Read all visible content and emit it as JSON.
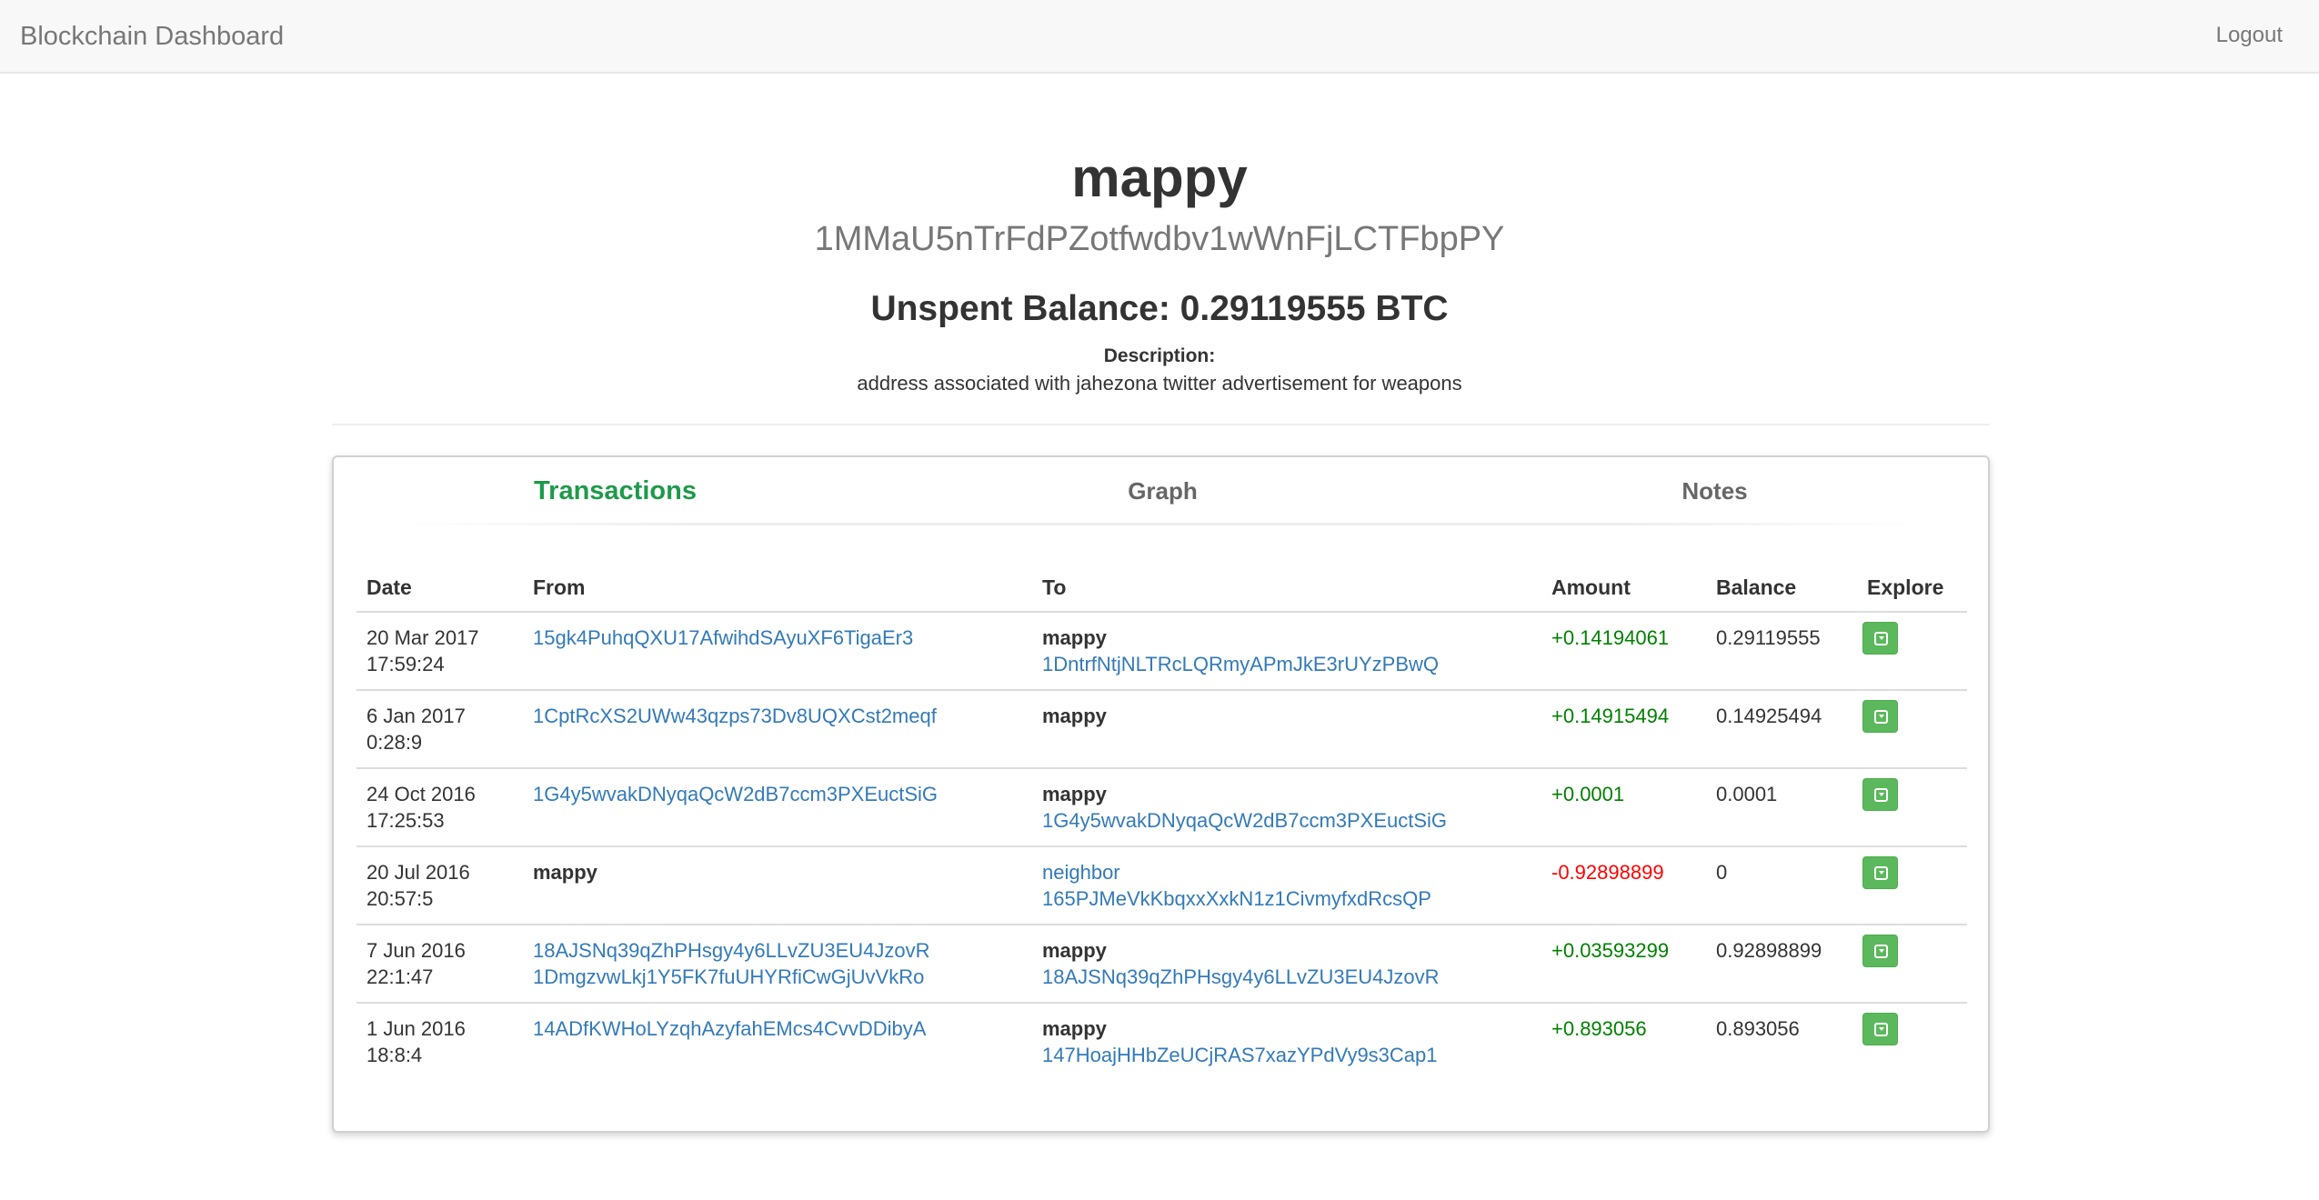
{
  "navbar": {
    "brand": "Blockchain Dashboard",
    "logout": "Logout"
  },
  "profile": {
    "name": "mappy",
    "address": "1MMaU5nTrFdPZotfwdbv1wWnFjLCTFbpPY",
    "balance": "Unspent Balance: 0.29119555 BTC",
    "description_label": "Description:",
    "description": "address associated with jahezona twitter advertisement for weapons"
  },
  "tabs": [
    {
      "label": "Transactions",
      "active": true
    },
    {
      "label": "Graph",
      "active": false
    },
    {
      "label": "Notes",
      "active": false
    }
  ],
  "table": {
    "headers": [
      "Date",
      "From",
      "To",
      "Amount",
      "Balance",
      "Explore"
    ],
    "rows": [
      {
        "date": [
          "20 Mar 2017",
          "17:59:24"
        ],
        "from": [
          {
            "text": "15gk4PuhqQXU17AfwihdSAyuXF6TigaEr3",
            "style": "link"
          }
        ],
        "to": [
          {
            "text": "mappy",
            "style": "bold"
          },
          {
            "text": "1DntrfNtjNLTRcLQRmyAPmJkE3rUYzPBwQ",
            "style": "link"
          }
        ],
        "amount": "+0.14194061",
        "amount_sign": "pos",
        "balance": "0.29119555"
      },
      {
        "date": [
          "6 Jan 2017",
          "0:28:9"
        ],
        "from": [
          {
            "text": "1CptRcXS2UWw43qzps73Dv8UQXCst2meqf",
            "style": "link"
          }
        ],
        "to": [
          {
            "text": "mappy",
            "style": "bold"
          }
        ],
        "amount": "+0.14915494",
        "amount_sign": "pos",
        "balance": "0.14925494"
      },
      {
        "date": [
          "24 Oct 2016",
          "17:25:53"
        ],
        "from": [
          {
            "text": "1G4y5wvakDNyqaQcW2dB7ccm3PXEuctSiG",
            "style": "link"
          }
        ],
        "to": [
          {
            "text": "mappy",
            "style": "bold"
          },
          {
            "text": "1G4y5wvakDNyqaQcW2dB7ccm3PXEuctSiG",
            "style": "link"
          }
        ],
        "amount": "+0.0001",
        "amount_sign": "pos",
        "balance": "0.0001"
      },
      {
        "date": [
          "20 Jul 2016",
          "20:57:5"
        ],
        "from": [
          {
            "text": "mappy",
            "style": "bold"
          }
        ],
        "to": [
          {
            "text": "neighbor",
            "style": "link"
          },
          {
            "text": "165PJMeVkKbqxxXxkN1z1CivmyfxdRcsQP",
            "style": "link"
          }
        ],
        "amount": "-0.92898899",
        "amount_sign": "neg",
        "balance": "0"
      },
      {
        "date": [
          "7 Jun 2016",
          "22:1:47"
        ],
        "from": [
          {
            "text": "18AJSNq39qZhPHsgy4y6LLvZU3EU4JzovR",
            "style": "link"
          },
          {
            "text": "1DmgzvwLkj1Y5FK7fuUHYRfiCwGjUvVkRo",
            "style": "link"
          }
        ],
        "to": [
          {
            "text": "mappy",
            "style": "bold"
          },
          {
            "text": "18AJSNq39qZhPHsgy4y6LLvZU3EU4JzovR",
            "style": "link"
          }
        ],
        "amount": "+0.03593299",
        "amount_sign": "pos",
        "balance": "0.92898899"
      },
      {
        "date": [
          "1 Jun 2016",
          "18:8:4"
        ],
        "from": [
          {
            "text": "14ADfKWHoLYzqhAzyfahEMcs4CvvDDibyA",
            "style": "link"
          }
        ],
        "to": [
          {
            "text": "mappy",
            "style": "bold"
          },
          {
            "text": "147HoajHHbZeUCjRAS7xazYPdVy9s3Cap1",
            "style": "link"
          }
        ],
        "amount": "+0.893056",
        "amount_sign": "pos",
        "balance": "0.893056"
      }
    ]
  },
  "colors": {
    "active_tab": "#1e9a4a",
    "positive": "#008000",
    "negative": "#ff0000",
    "link": "#337ab7",
    "button": "#5cb85c"
  },
  "icons": {
    "explore": "caret-square-down-icon"
  }
}
